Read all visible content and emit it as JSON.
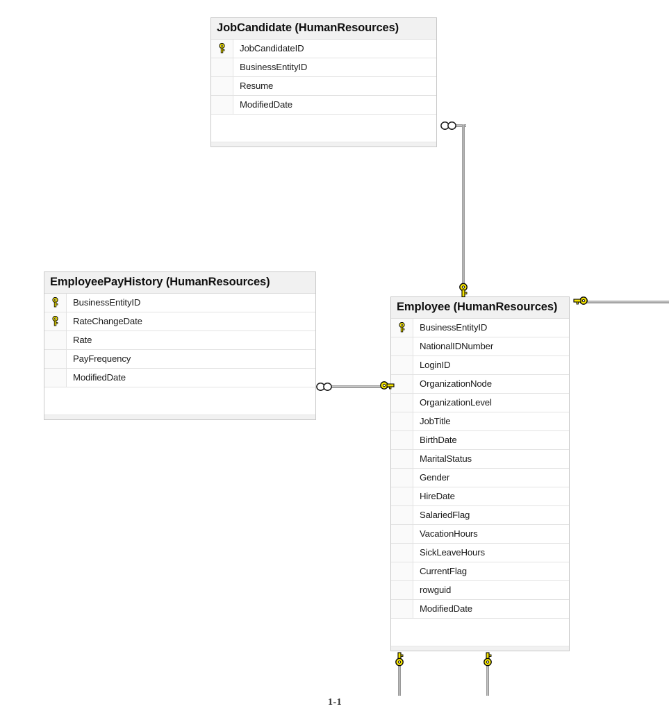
{
  "diagram": {
    "page_label": "1-1",
    "colors": {
      "key_yellow": "#f5e400",
      "key_outline": "#000000",
      "table_border": "#c8c8c8",
      "header_bg": "#f1f1f1",
      "row_divider": "#e2e2e2",
      "connector": "#8d8d8d",
      "canvas_bg": "#ffffff"
    },
    "tables": [
      {
        "id": "jobcandidate",
        "title": "JobCandidate (HumanResources)",
        "name": "JobCandidate",
        "schema": "HumanResources",
        "fields": [
          {
            "name": "JobCandidateID",
            "is_key": true
          },
          {
            "name": "BusinessEntityID",
            "is_key": false
          },
          {
            "name": "Resume",
            "is_key": false
          },
          {
            "name": "ModifiedDate",
            "is_key": false
          }
        ]
      },
      {
        "id": "employeepayhistory",
        "title": "EmployeePayHistory (HumanResources)",
        "name": "EmployeePayHistory",
        "schema": "HumanResources",
        "fields": [
          {
            "name": "BusinessEntityID",
            "is_key": true
          },
          {
            "name": "RateChangeDate",
            "is_key": true
          },
          {
            "name": "Rate",
            "is_key": false
          },
          {
            "name": "PayFrequency",
            "is_key": false
          },
          {
            "name": "ModifiedDate",
            "is_key": false
          }
        ]
      },
      {
        "id": "employee",
        "title": "Employee (HumanResources)",
        "name": "Employee",
        "schema": "HumanResources",
        "fields": [
          {
            "name": "BusinessEntityID",
            "is_key": true
          },
          {
            "name": "NationalIDNumber",
            "is_key": false
          },
          {
            "name": "LoginID",
            "is_key": false
          },
          {
            "name": "OrganizationNode",
            "is_key": false
          },
          {
            "name": "OrganizationLevel",
            "is_key": false
          },
          {
            "name": "JobTitle",
            "is_key": false
          },
          {
            "name": "BirthDate",
            "is_key": false
          },
          {
            "name": "MaritalStatus",
            "is_key": false
          },
          {
            "name": "Gender",
            "is_key": false
          },
          {
            "name": "HireDate",
            "is_key": false
          },
          {
            "name": "SalariedFlag",
            "is_key": false
          },
          {
            "name": "VacationHours",
            "is_key": false
          },
          {
            "name": "SickLeaveHours",
            "is_key": false
          },
          {
            "name": "CurrentFlag",
            "is_key": false
          },
          {
            "name": "rowguid",
            "is_key": false
          },
          {
            "name": "ModifiedDate",
            "is_key": false
          }
        ]
      }
    ],
    "relationships": [
      {
        "id": "rel-jobcandidate-employee",
        "many_side": "JobCandidate",
        "one_side": "Employee"
      },
      {
        "id": "rel-payhistory-employee",
        "many_side": "EmployeePayHistory",
        "one_side": "Employee"
      },
      {
        "id": "rel-employee-right",
        "many_side": "",
        "one_side": "Employee"
      },
      {
        "id": "rel-employee-bottom-left",
        "many_side": "",
        "one_side": "Employee"
      },
      {
        "id": "rel-employee-bottom-right",
        "many_side": "",
        "one_side": "Employee"
      }
    ]
  }
}
